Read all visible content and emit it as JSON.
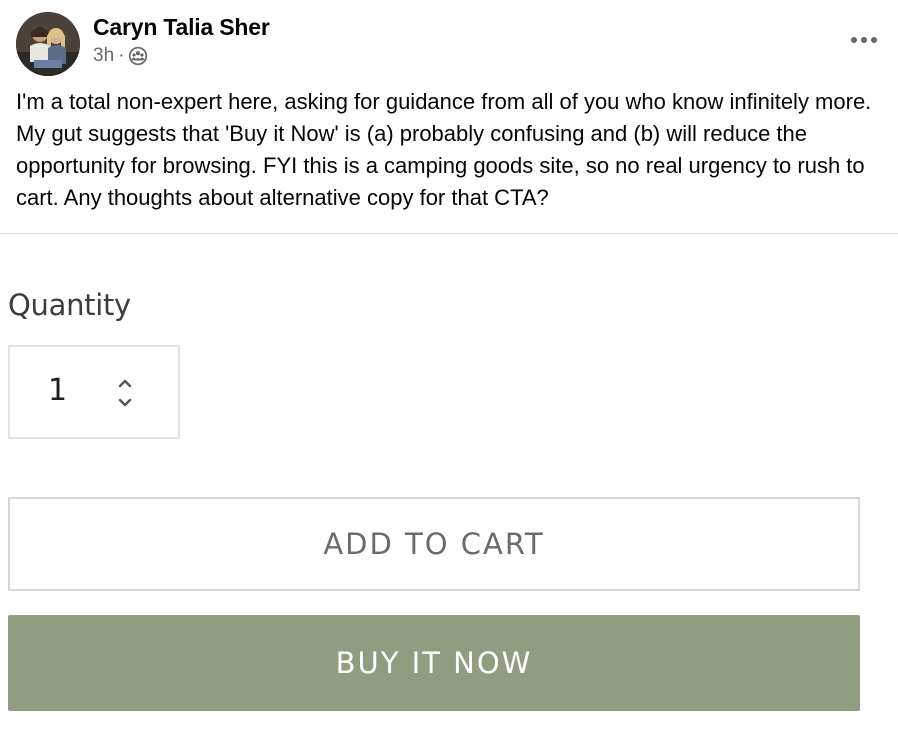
{
  "post": {
    "author": "Caryn Talia Sher",
    "time": "3h",
    "separator": "·",
    "audience_icon": "friends-icon",
    "more_icon": "more-options-icon",
    "body": "I'm a total non-expert here, asking for guidance from all of you who know infinitely more. My gut suggests that 'Buy it Now' is (a) probably confusing and (b) will reduce the opportunity for browsing. FYI this is a camping goods site, so no real urgency to rush to cart. Any thoughts about alternative copy for that CTA?"
  },
  "product": {
    "quantity_label": "Quantity",
    "quantity_value": "1",
    "stepper_icon": "up-down-chevron-icon",
    "add_to_cart_label": "ADD TO CART",
    "buy_now_label": "BUY IT NOW"
  },
  "colors": {
    "buy_now_bg": "#919d80",
    "meta_text": "#65676b"
  }
}
